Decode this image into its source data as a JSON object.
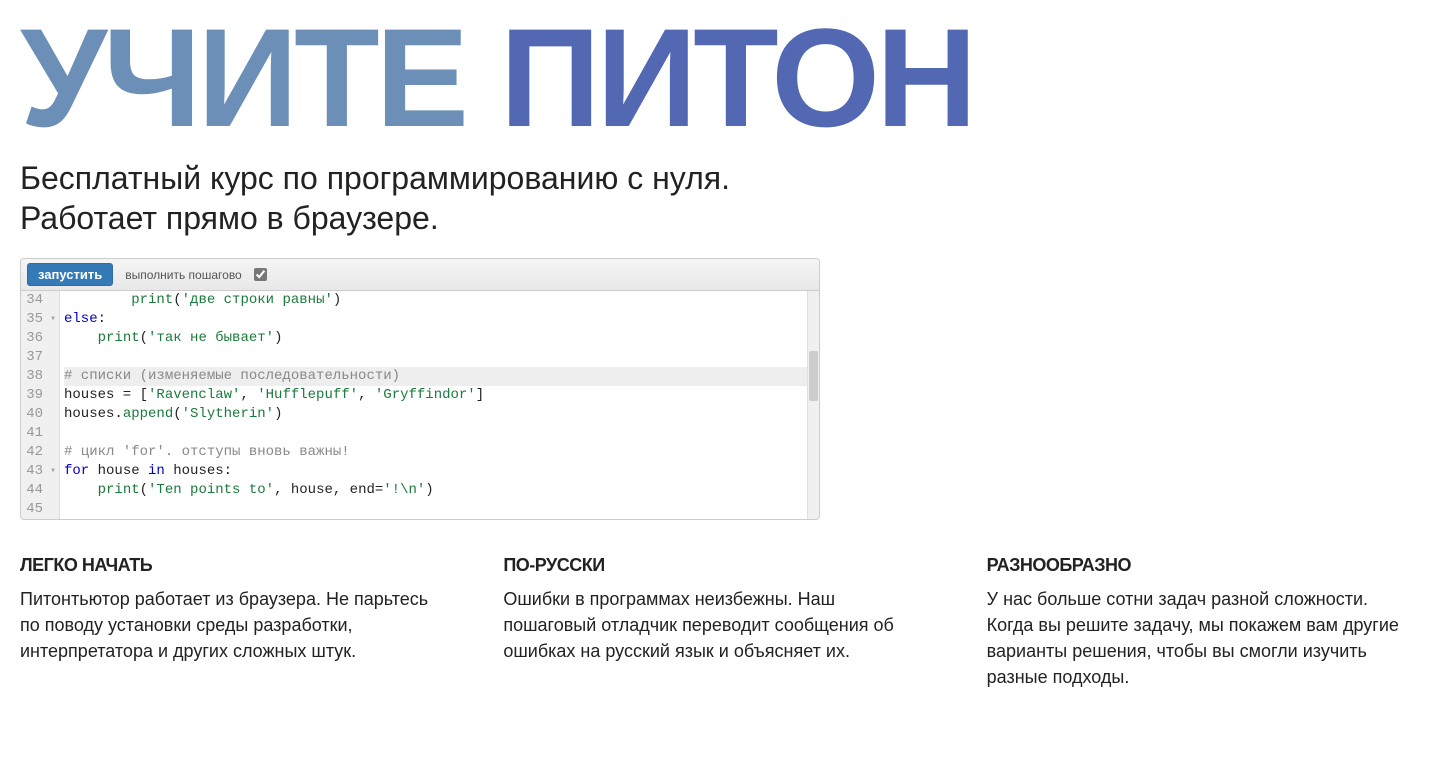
{
  "logo": {
    "word1": "УЧИТЕ",
    "word2": "ПИТОН"
  },
  "subtitle_line1": "Бесплатный курс по программированию с нуля.",
  "subtitle_line2": "Работает прямо в браузере.",
  "editor": {
    "run_label": "запустить",
    "step_label": "выполнить пошагово",
    "step_checked": true,
    "lines": [
      {
        "n": 34,
        "fold": "",
        "hl": false,
        "tokens": [
          {
            "t": "        ",
            "c": ""
          },
          {
            "t": "print",
            "c": "fn"
          },
          {
            "t": "(",
            "c": "nm"
          },
          {
            "t": "'две строки равны'",
            "c": "str"
          },
          {
            "t": ")",
            "c": "nm"
          }
        ]
      },
      {
        "n": 35,
        "fold": "▾",
        "hl": false,
        "tokens": [
          {
            "t": "else",
            "c": "kw"
          },
          {
            "t": ":",
            "c": "nm"
          }
        ]
      },
      {
        "n": 36,
        "fold": "",
        "hl": false,
        "tokens": [
          {
            "t": "    ",
            "c": ""
          },
          {
            "t": "print",
            "c": "fn"
          },
          {
            "t": "(",
            "c": "nm"
          },
          {
            "t": "'так не бывает'",
            "c": "str"
          },
          {
            "t": ")",
            "c": "nm"
          }
        ]
      },
      {
        "n": 37,
        "fold": "",
        "hl": false,
        "tokens": []
      },
      {
        "n": 38,
        "fold": "",
        "hl": true,
        "tokens": [
          {
            "t": "# списки (изменяемые последовательности)",
            "c": "com"
          }
        ]
      },
      {
        "n": 39,
        "fold": "",
        "hl": false,
        "tokens": [
          {
            "t": "houses = [",
            "c": "nm"
          },
          {
            "t": "'Ravenclaw'",
            "c": "str"
          },
          {
            "t": ", ",
            "c": "nm"
          },
          {
            "t": "'Hufflepuff'",
            "c": "str"
          },
          {
            "t": ", ",
            "c": "nm"
          },
          {
            "t": "'Gryffindor'",
            "c": "str"
          },
          {
            "t": "]",
            "c": "nm"
          }
        ]
      },
      {
        "n": 40,
        "fold": "",
        "hl": false,
        "tokens": [
          {
            "t": "houses.",
            "c": "nm"
          },
          {
            "t": "append",
            "c": "fn"
          },
          {
            "t": "(",
            "c": "nm"
          },
          {
            "t": "'Slytherin'",
            "c": "str"
          },
          {
            "t": ")",
            "c": "nm"
          }
        ]
      },
      {
        "n": 41,
        "fold": "",
        "hl": false,
        "tokens": []
      },
      {
        "n": 42,
        "fold": "",
        "hl": false,
        "tokens": [
          {
            "t": "# цикл 'for'. отступы вновь важны!",
            "c": "com"
          }
        ]
      },
      {
        "n": 43,
        "fold": "▾",
        "hl": false,
        "tokens": [
          {
            "t": "for",
            "c": "kw"
          },
          {
            "t": " house ",
            "c": "nm"
          },
          {
            "t": "in",
            "c": "kw"
          },
          {
            "t": " houses:",
            "c": "nm"
          }
        ]
      },
      {
        "n": 44,
        "fold": "",
        "hl": false,
        "tokens": [
          {
            "t": "    ",
            "c": ""
          },
          {
            "t": "print",
            "c": "fn"
          },
          {
            "t": "(",
            "c": "nm"
          },
          {
            "t": "'Ten points to'",
            "c": "str"
          },
          {
            "t": ", house, end=",
            "c": "nm"
          },
          {
            "t": "'!\\n'",
            "c": "str"
          },
          {
            "t": ")",
            "c": "nm"
          }
        ]
      },
      {
        "n": 45,
        "fold": "",
        "hl": false,
        "tokens": []
      }
    ]
  },
  "features": [
    {
      "title": "ЛЕГКО НАЧАТЬ",
      "body": "Питонтьютор работает из браузера. Не парьтесь по поводу установки среды разработки, интерпретатора и других сложных штук."
    },
    {
      "title": "ПО-РУССКИ",
      "body": "Ошибки в программах неизбежны. Наш пошаговый отладчик переводит сообщения об ошибках на русский язык и объясняет их."
    },
    {
      "title": "РАЗНООБРАЗНО",
      "body": "У нас больше сотни задач разной сложности. Когда вы решите задачу, мы покажем вам другие варианты решения, чтобы вы смогли изучить разные подходы."
    }
  ]
}
